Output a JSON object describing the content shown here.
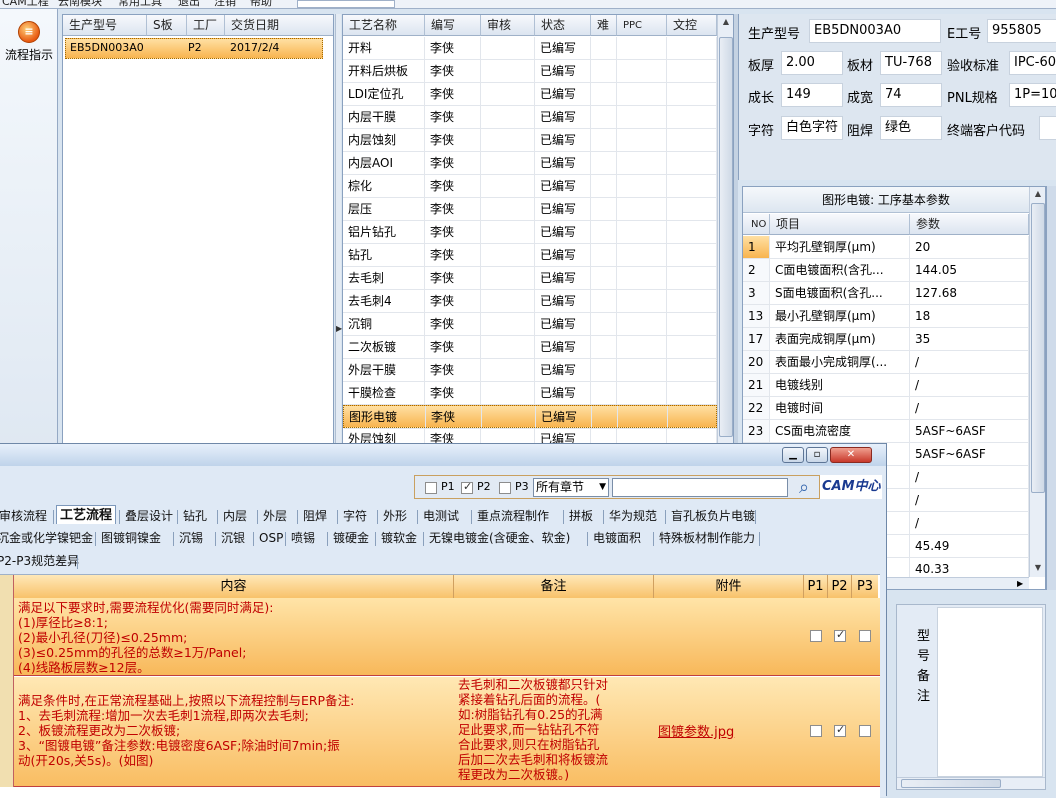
{
  "menu": [
    "CAM工程",
    "云南模块",
    "常用工具",
    "退出",
    "注销",
    "帮助"
  ],
  "left_toolbar": {
    "flow_button": "流程指示",
    "flow_icon": "flow-icon"
  },
  "orders": {
    "headers": [
      "生产型号",
      "S板",
      "工厂",
      "交货日期"
    ],
    "rows": [
      [
        "EB5DN003A0",
        "",
        "P2",
        "2017/2/4"
      ]
    ]
  },
  "process": {
    "headers": [
      "工艺名称",
      "编写",
      "审核",
      "状态",
      "难",
      "PPC",
      "文控"
    ],
    "rows": [
      [
        "开料",
        "李侠",
        "",
        "已编写"
      ],
      [
        "开料后烘板",
        "李侠",
        "",
        "已编写"
      ],
      [
        "LDI定位孔",
        "李侠",
        "",
        "已编写"
      ],
      [
        "内层干膜",
        "李侠",
        "",
        "已编写"
      ],
      [
        "内层蚀刻",
        "李侠",
        "",
        "已编写"
      ],
      [
        "内层AOI",
        "李侠",
        "",
        "已编写"
      ],
      [
        "棕化",
        "李侠",
        "",
        "已编写"
      ],
      [
        "层压",
        "李侠",
        "",
        "已编写"
      ],
      [
        "铝片钻孔",
        "李侠",
        "",
        "已编写"
      ],
      [
        "钻孔",
        "李侠",
        "",
        "已编写"
      ],
      [
        "去毛刺",
        "李侠",
        "",
        "已编写"
      ],
      [
        "去毛刺4",
        "李侠",
        "",
        "已编写"
      ],
      [
        "沉铜",
        "李侠",
        "",
        "已编写"
      ],
      [
        "二次板镀",
        "李侠",
        "",
        "已编写"
      ],
      [
        "外层干膜",
        "李侠",
        "",
        "已编写"
      ],
      [
        "干膜检查",
        "李侠",
        "",
        "已编写"
      ],
      [
        "图形电镀",
        "李侠",
        "",
        "已编写"
      ],
      [
        "外层蚀刻",
        "李侠",
        "",
        "已编写"
      ]
    ],
    "selected_index": 16
  },
  "info": {
    "model_label": "生产型号",
    "model": "EB5DN003A0",
    "e_label": "E工号",
    "e_no": "955805",
    "thick_label": "板厚",
    "thick": "2.00",
    "mat_label": "板材",
    "mat": "TU-768",
    "std_label": "验收标准",
    "std": "IPC-60",
    "len_label": "成长",
    "len": "149",
    "wid_label": "成宽",
    "wid": "74",
    "pnl_label": "PNL规格",
    "pnl": "1P=10",
    "char_label": "字符",
    "char": "白色字符",
    "mask_label": "阻焊",
    "mask": "绿色",
    "cust_label": "终端客户代码",
    "cust": ""
  },
  "params": {
    "title": "图形电镀: 工序基本参数",
    "headers": [
      "NO",
      "项目",
      "参数"
    ],
    "rows": [
      [
        "1",
        "平均孔壁铜厚(μm)",
        "20"
      ],
      [
        "2",
        "C面电镀面积(含孔...",
        "144.05"
      ],
      [
        "3",
        "S面电镀面积(含孔...",
        "127.68"
      ],
      [
        "13",
        "最小孔壁铜厚(μm)",
        "18"
      ],
      [
        "17",
        "表面完成铜厚(μm)",
        "35"
      ],
      [
        "20",
        "表面最小完成铜厚(...",
        "/"
      ],
      [
        "21",
        "电镀线别",
        "/"
      ],
      [
        "22",
        "电镀时间",
        "/"
      ],
      [
        "23",
        "CS面电流密度",
        "5ASF~6ASF"
      ],
      [
        "",
        "",
        "5ASF~6ASF"
      ],
      [
        "",
        "",
        "/"
      ],
      [
        "",
        "",
        "/"
      ],
      [
        "",
        "",
        "/"
      ],
      [
        "",
        "",
        "45.49"
      ],
      [
        "",
        "",
        "40.33"
      ]
    ]
  },
  "remark": {
    "label_chars": [
      "型",
      "号",
      "备",
      "注"
    ]
  },
  "popup": {
    "filters": [
      {
        "label": "P1",
        "checked": false
      },
      {
        "label": "P2",
        "checked": true
      },
      {
        "label": "P3",
        "checked": false
      }
    ],
    "chapter": "所有章节",
    "search": "",
    "logo": "CAM中心",
    "tabs_row1": [
      "审核流程",
      "工艺流程",
      "叠层设计",
      "钻孔",
      "内层",
      "外层",
      "阻焊",
      "字符",
      "外形",
      "电测试",
      "重点流程制作",
      "拼板",
      "华为规范",
      "盲孔板负片电镀"
    ],
    "tabs_row2": [
      "沉金或化学镍钯金",
      "图镀铜镍金",
      "沉锡",
      "沉银",
      "OSP",
      "喷锡",
      "镀硬金",
      "镀软金",
      "无镍电镀金(含硬金、软金)",
      "电镀面积",
      "特殊板材制作能力"
    ],
    "tabs_row3": [
      "P2-P3规范差异"
    ],
    "active_tab": "工艺流程",
    "headers": {
      "content": "内容",
      "note": "备注",
      "attach": "附件",
      "p1": "P1",
      "p2": "P2",
      "p3": "P3"
    },
    "rows": [
      {
        "content": [
          "满足以下要求时,需要流程优化(需要同时满足):",
          "(1)厚径比≥8:1;",
          "(2)最小孔径(刀径)≤0.25mm;",
          "(3)≤0.25mm的孔径的总数≥1万/Panel;",
          "(4)线路板层数≥12层。"
        ],
        "note": [],
        "attach": "",
        "p1": false,
        "p2": true,
        "p3": false
      },
      {
        "content": [
          "满足条件时,在正常流程基础上,按照以下流程控制与ERP备注:",
          "1、去毛刺流程:增加一次去毛刺1流程,即两次去毛刺;",
          "2、板镀流程更改为二次板镀;",
          "3、“图镀电镀”备注参数:电镀密度6ASF;除油时间7min;振",
          "动(开20s,关5s)。(如图)"
        ],
        "note": [
          "去毛刺和二次板镀都只针对",
          "紧接着钻孔后面的流程。(",
          "如:树脂钻孔有0.25的孔满",
          "足此要求,而一钻钻孔不符",
          "合此要求,则只在树脂钻孔",
          "后加二次去毛刺和将板镀流",
          "程更改为二次板镀。)"
        ],
        "attach": "图镀参数.jpg",
        "p1": false,
        "p2": true,
        "p3": false
      }
    ]
  }
}
